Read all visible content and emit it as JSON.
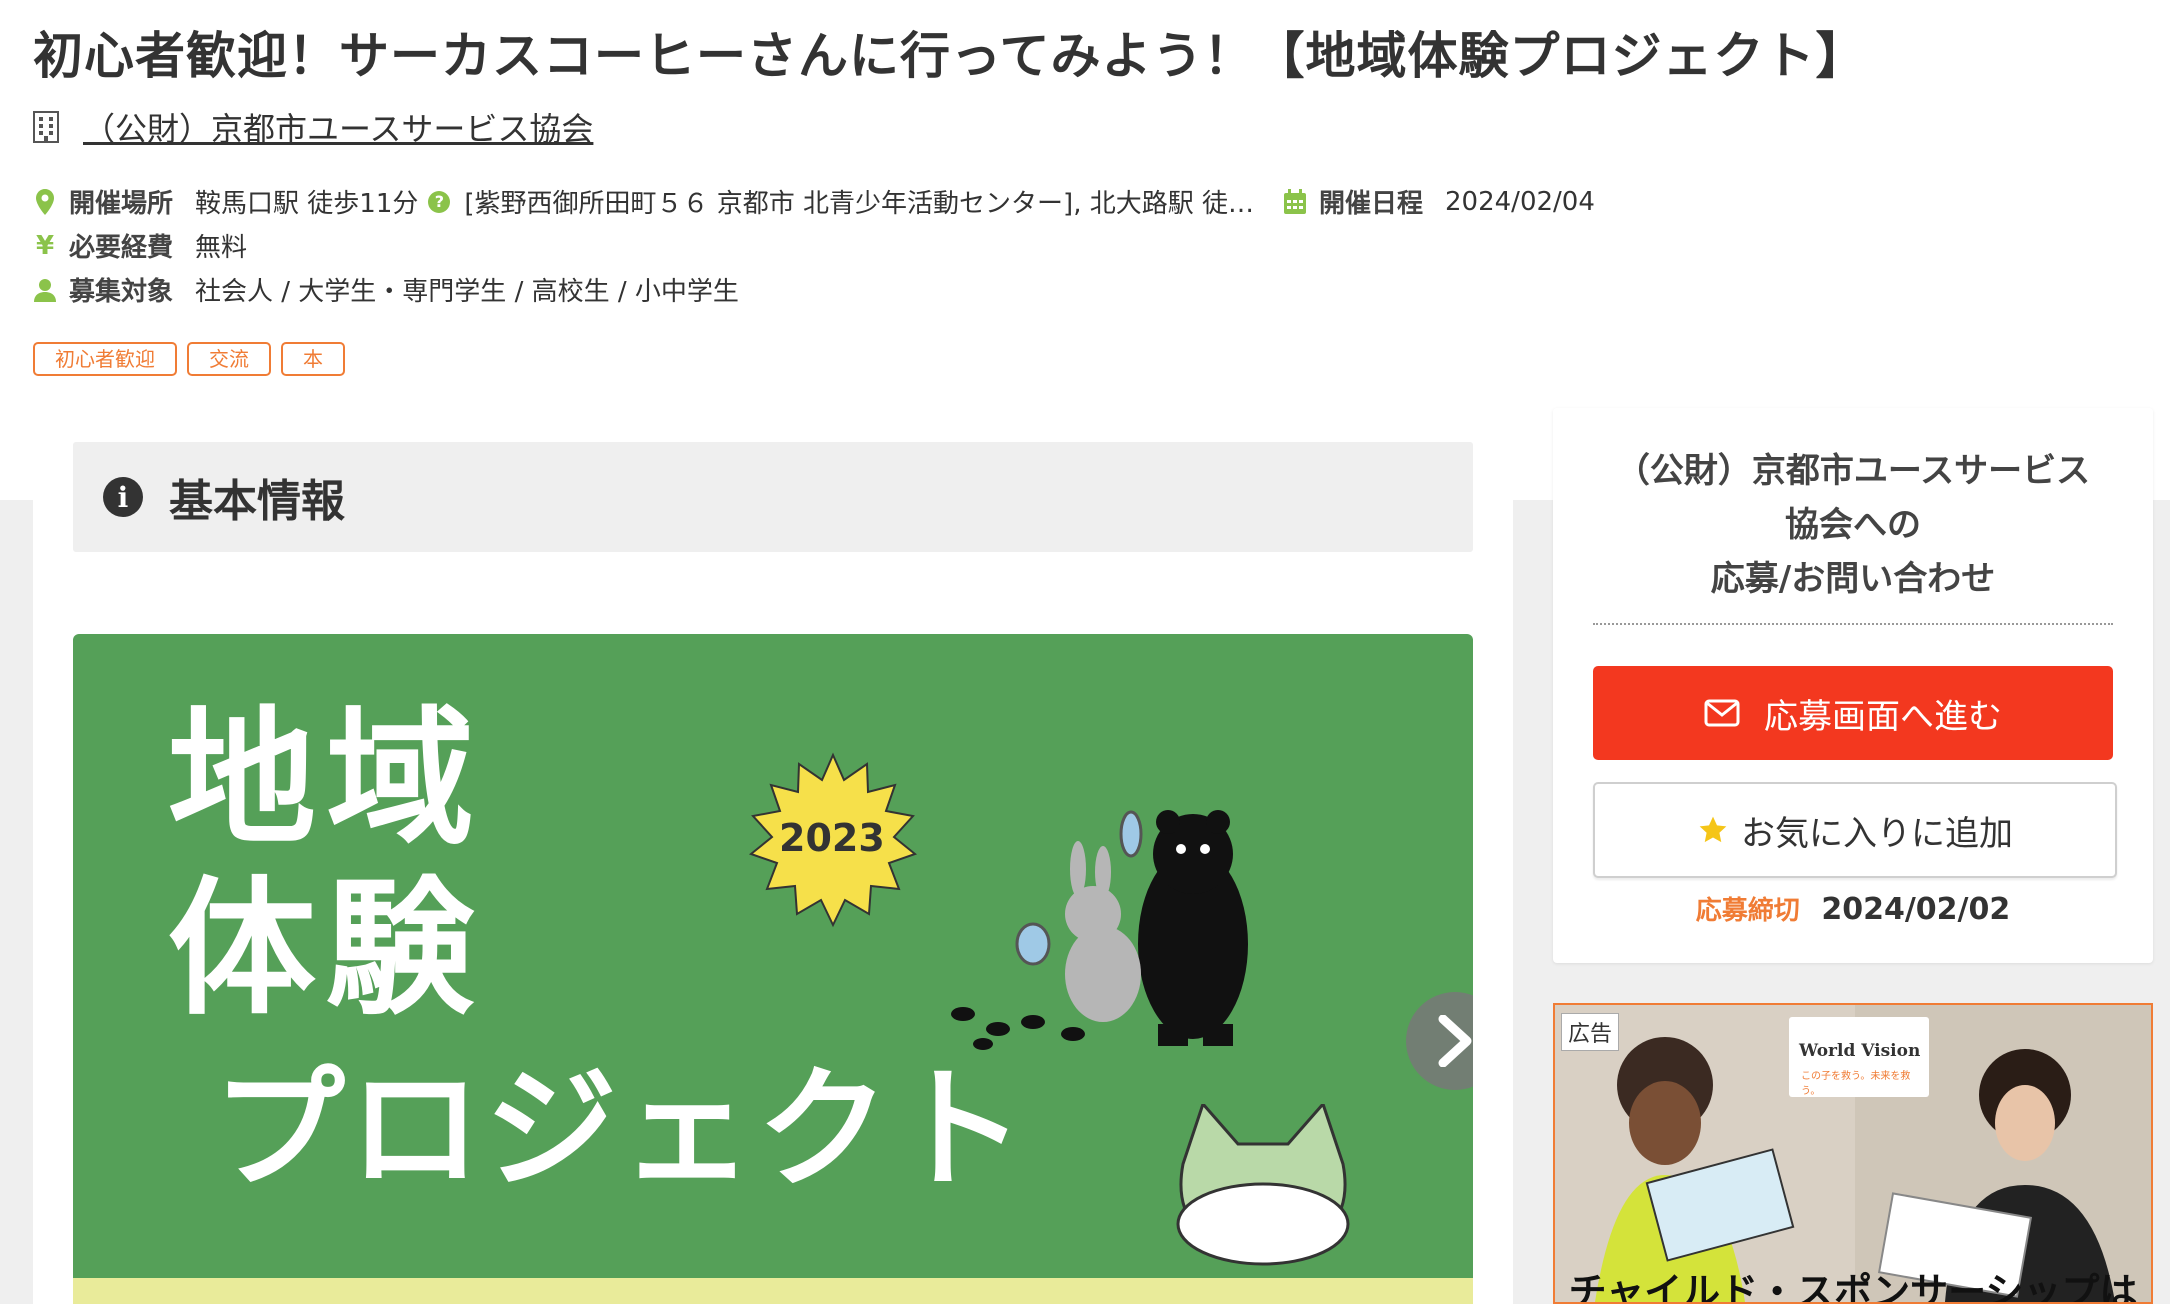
{
  "page": {
    "title": "初心者歓迎！サーカスコーヒーさんに行ってみよう！【地域体験プロジェクト】",
    "organizer": "（公財）京都市ユースサービス協会"
  },
  "info": {
    "location_label": "開催場所",
    "location_value": "鞍馬口駅 徒歩11分",
    "location_extra": "[紫野西御所田町５６ 京都市 北青少年活動センター], 北大路駅 徒…",
    "date_label": "開催日程",
    "date_value": "2024/02/04",
    "cost_label": "必要経費",
    "cost_value": "無料",
    "target_label": "募集対象",
    "target_value": "社会人 / 大学生・専門学生 / 高校生 / 小中学生"
  },
  "tags": [
    "初心者歓迎",
    "交流",
    "本"
  ],
  "section": {
    "basic_info_title": "基本情報"
  },
  "hero": {
    "line1": "地域",
    "line2": "体験",
    "line3": "プロジェクト",
    "year_badge": "2023"
  },
  "sidebar": {
    "title_line1": "（公財）京都市ユースサービス",
    "title_line2": "協会への",
    "title_line3": "応募/お問い合わせ",
    "apply_label": "応募画面へ進む",
    "favorite_label": "お気に入りに追加",
    "deadline_label": "応募締切",
    "deadline_value": "2024/02/02"
  },
  "ad": {
    "badge": "広告",
    "brand": "World Vision",
    "brand_sub": "この子を救う。未来を救う。",
    "caption": "チャイルド・スポンサーシップは"
  },
  "colors": {
    "accent_orange": "#f07c35",
    "apply_red": "#f3381f",
    "icon_green": "#8bc34a",
    "hero_green": "#55a058"
  }
}
